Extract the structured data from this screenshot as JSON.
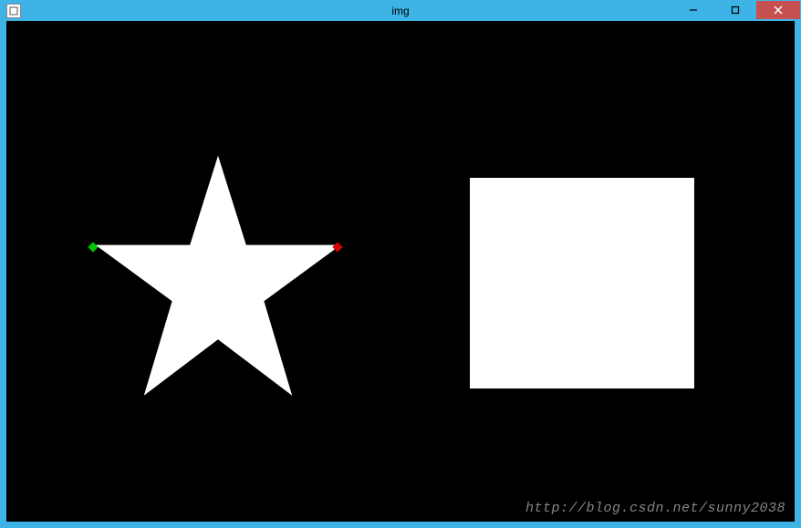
{
  "window": {
    "title": "img",
    "controls": {
      "minimize_tooltip": "Minimize",
      "maximize_tooltip": "Maximize",
      "close_tooltip": "Close"
    }
  },
  "canvas": {
    "background": "#000000",
    "shapes": [
      {
        "type": "star",
        "fill": "#ffffff"
      },
      {
        "type": "rectangle",
        "fill": "#ffffff"
      }
    ],
    "markers": [
      {
        "color": "#00c800",
        "name": "left-point"
      },
      {
        "color": "#d80000",
        "name": "right-point"
      }
    ]
  },
  "watermark": "http://blog.csdn.net/sunny2038"
}
